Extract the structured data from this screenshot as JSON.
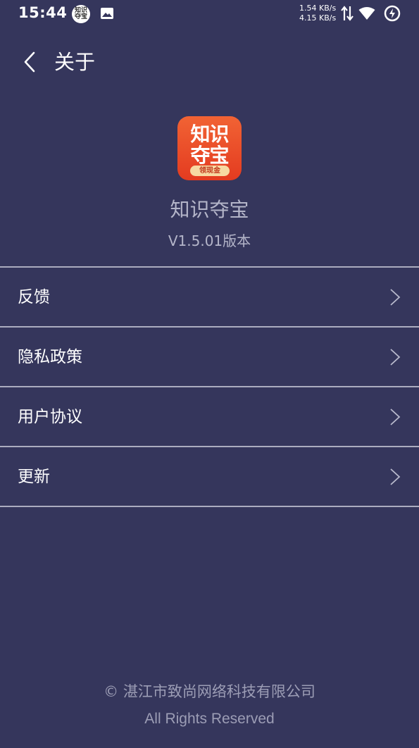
{
  "status_bar": {
    "time": "15:44",
    "app_icon_text": [
      "知识",
      "夺宝"
    ],
    "speed_up": "1.54 KB/s",
    "speed_down": "4.15 KB/s"
  },
  "header": {
    "title": "关于"
  },
  "app": {
    "logo_line1": "知识",
    "logo_line2": "夺宝",
    "logo_badge": "领现金",
    "name": "知识夺宝",
    "version": "V1.5.01版本",
    "logo_color": "#ea4b26"
  },
  "menu": {
    "items": [
      {
        "label": "反馈"
      },
      {
        "label": "隐私政策"
      },
      {
        "label": "用户协议"
      },
      {
        "label": "更新"
      }
    ]
  },
  "footer": {
    "company": "© 湛江市致尚网络科技有限公司",
    "rights": "All Rights Reserved"
  },
  "colors": {
    "background": "#35365c",
    "divider": "#c9cad8"
  }
}
